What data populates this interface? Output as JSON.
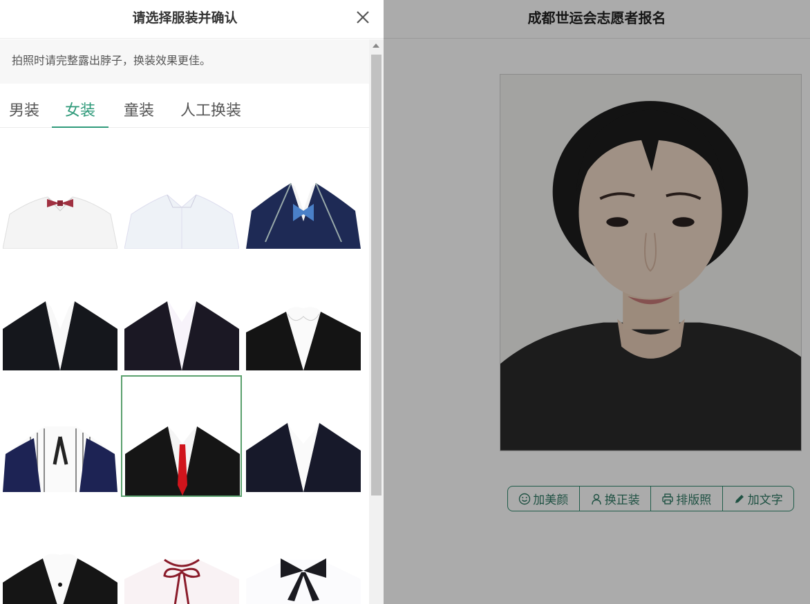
{
  "app": {
    "title": "成都世运会志愿者报名"
  },
  "toolbar": {
    "items": [
      {
        "label": "加美颜",
        "icon": "smile-icon"
      },
      {
        "label": "换正装",
        "icon": "person-icon"
      },
      {
        "label": "排版照",
        "icon": "printer-icon"
      },
      {
        "label": "加文字",
        "icon": "pencil-icon"
      }
    ]
  },
  "drawer": {
    "title": "请选择服装并确认",
    "close_icon": "close-icon",
    "notice": "拍照时请完整露出脖子，换装效果更佳。",
    "tabs": [
      {
        "label": "男装",
        "active": false
      },
      {
        "label": "女装",
        "active": true
      },
      {
        "label": "童装",
        "active": false
      },
      {
        "label": "人工换装",
        "active": false
      }
    ],
    "selected_outfit_index": 7,
    "outfits": [
      "white-shirt-red-bowtie",
      "white-shirt",
      "navy-blazer-blue-bowtie",
      "black-blazer-white-shirt",
      "dark-blazer-white-shirt",
      "black-blazer-round-collar",
      "navy-vest-striped-shirt-ribbon",
      "black-suit-red-tie",
      "navy-blazer-white-shirt",
      "black-blazer-button",
      "white-blouse-red-ribbon",
      "white-blouse-black-bow"
    ]
  },
  "colors": {
    "accent": "#2f9a7a",
    "selected_border": "#5aa06d",
    "toolbar_border": "#2f8a6e"
  }
}
